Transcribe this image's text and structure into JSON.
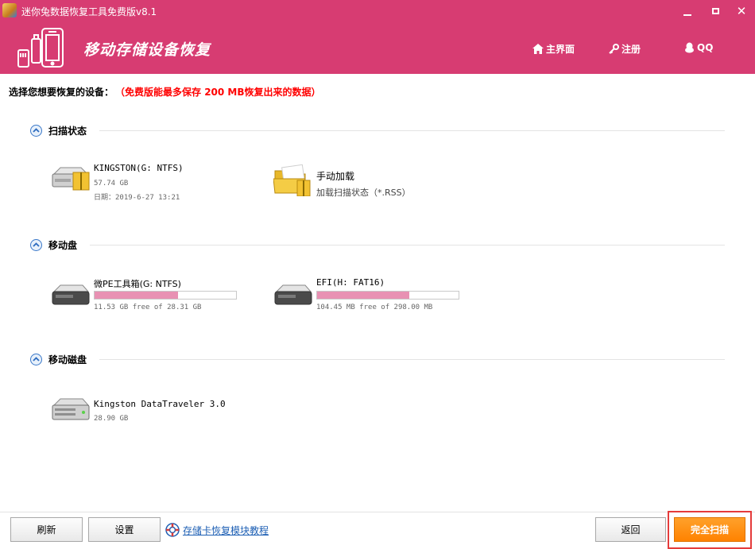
{
  "window": {
    "title": "迷你兔数据恢复工具免费版v8.1",
    "controls": {
      "minimize_icon": "minimize-icon",
      "maximize_icon": "maximize-icon",
      "close_icon": "close-icon"
    }
  },
  "header": {
    "background": "#d73c72",
    "title": "移动存储设备恢复",
    "nav": [
      {
        "label": "主界面",
        "icon": "home-icon"
      },
      {
        "label": "注册",
        "icon": "key-icon"
      },
      {
        "label": "QQ",
        "icon": "qq-penguin-icon"
      }
    ]
  },
  "notice": {
    "label": "选择您想要恢复的设备：",
    "warning": "（免费版能最多保存 200 MB恢复出来的数据）",
    "warning_color": "#ff0000"
  },
  "sections": {
    "scan_status": {
      "title": "扫描状态",
      "items": [
        {
          "name": "KINGSTON(G: NTFS)",
          "size": "57.74 GB",
          "date": "日期：2019-6-27 13:21",
          "icon": "hard-drive-icon"
        },
        {
          "name": "手动加载",
          "desc": "加载扫描状态（*.RSS）",
          "icon": "folder-icon"
        }
      ]
    },
    "removable": {
      "title": "移动盘",
      "items": [
        {
          "name": "微PE工具箱(G: NTFS)",
          "usage": "11.53 GB free of 28.31 GB",
          "used_fraction": 0.59,
          "icon": "drive-icon"
        },
        {
          "name": "EFI(H: FAT16)",
          "usage": "104.45 MB free of 298.00 MB",
          "used_fraction": 0.65,
          "icon": "drive-icon"
        }
      ]
    },
    "mobile_disk": {
      "title": "移动磁盘",
      "items": [
        {
          "name": "Kingston DataTraveler 3.0",
          "size": "28.90 GB",
          "icon": "disk-icon"
        }
      ]
    }
  },
  "footer": {
    "refresh": "刷新",
    "settings": "设置",
    "tutorial": "存储卡恢复模块教程",
    "back": "返回",
    "full_scan": "完全扫描",
    "accent": "#ff8a00"
  }
}
